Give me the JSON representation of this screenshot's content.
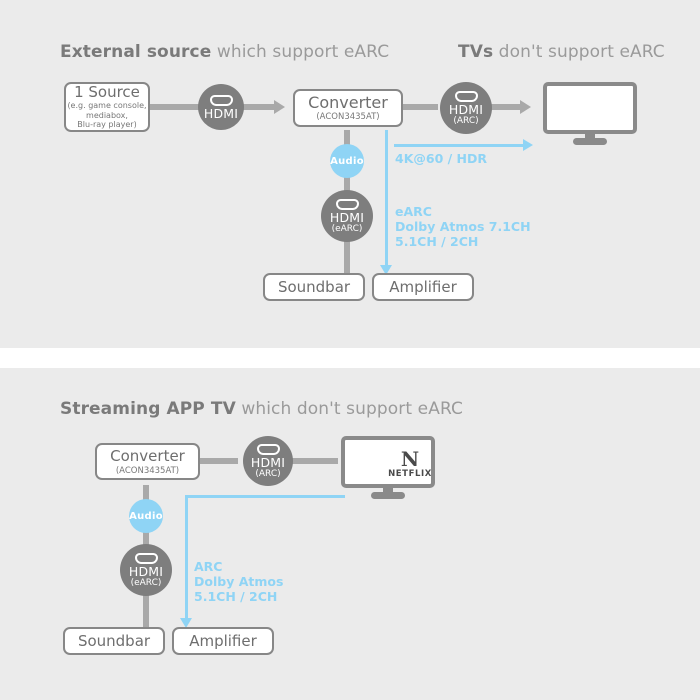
{
  "colors": {
    "panel_bg": "#ebebeb",
    "page_bg": "#ffffff",
    "gray_line": "#a9a9a9",
    "box_border": "#878787",
    "badge_gray": "#7e7e7e",
    "audio_blue": "#8fd4f5",
    "heading_text": "#8c8c8c"
  },
  "panels": [
    {
      "id": "top",
      "heading": {
        "strong": "External source",
        "rest": " which support eARC"
      },
      "heading2": {
        "strong": "TVs",
        "rest": " don't support eARC"
      },
      "source_box": {
        "title": "1 Source",
        "sub_line1": "(e.g. game console,",
        "sub_line2": "mediabox,",
        "sub_line3": "Blu-ray player)"
      },
      "converter_box": {
        "title": "Converter",
        "model": "(ACON3435AT)"
      },
      "badges": [
        {
          "name": "hdmi-badge-source",
          "label": "HDMI",
          "sub": ""
        },
        {
          "name": "hdmi-badge-arc",
          "label": "HDMI",
          "sub": "(ARC)"
        },
        {
          "name": "audio-badge",
          "label": "Audio",
          "sub": ""
        },
        {
          "name": "hdmi-badge-earc",
          "label": "HDMI",
          "sub": "(eARC)"
        }
      ],
      "video_label": "4K@60 / HDR",
      "audio_label_line1": "eARC",
      "audio_label_line2": "Dolby Atmos 7.1CH",
      "audio_label_line3": "5.1CH / 2CH",
      "soundbar_box": "Soundbar",
      "amplifier_box": "Amplifier"
    },
    {
      "id": "bottom",
      "heading": {
        "strong": "Streaming APP TV",
        "rest": " which don't support eARC"
      },
      "converter_box": {
        "title": "Converter",
        "model": "(ACON3435AT)"
      },
      "tv_logo": {
        "mark": "N",
        "wordmark": "NETFLIX"
      },
      "badges": [
        {
          "name": "hdmi-badge-arc",
          "label": "HDMI",
          "sub": "(ARC)"
        },
        {
          "name": "audio-badge",
          "label": "Audio",
          "sub": ""
        },
        {
          "name": "hdmi-badge-earc",
          "label": "HDMI",
          "sub": "(eARC)"
        }
      ],
      "audio_label_line1": "ARC",
      "audio_label_line2": "Dolby Atmos",
      "audio_label_line3": "5.1CH / 2CH",
      "soundbar_box": "Soundbar",
      "amplifier_box": "Amplifier"
    }
  ]
}
